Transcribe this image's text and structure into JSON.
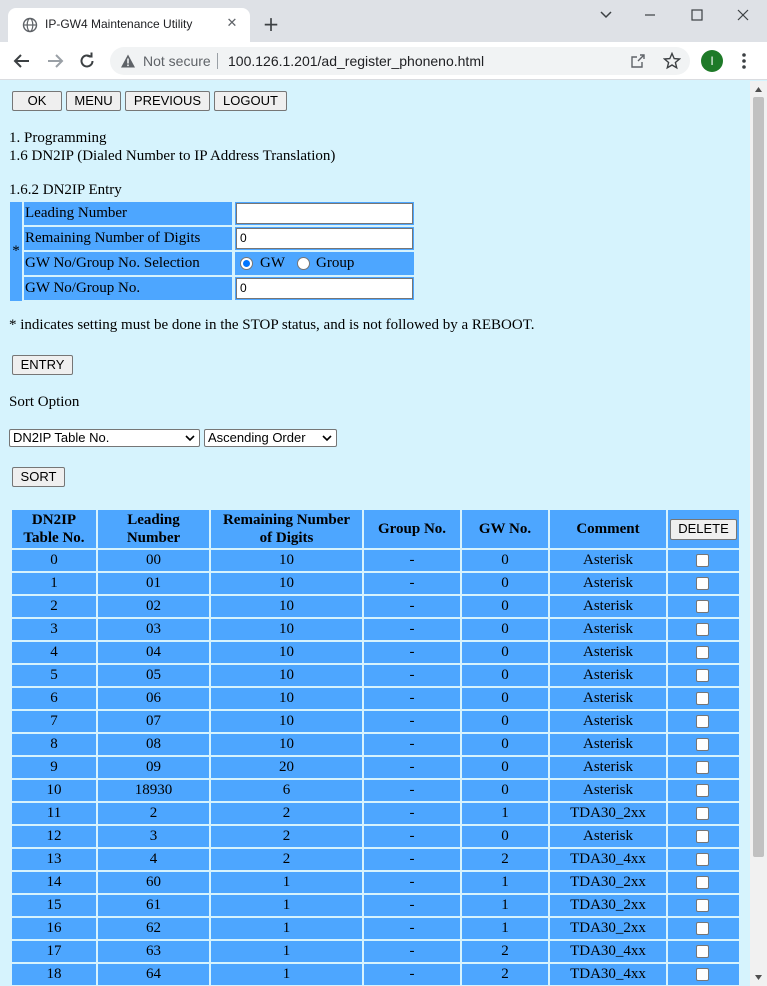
{
  "browser": {
    "tab_title": "IP-GW4 Maintenance Utility",
    "tab_close": "✕",
    "new_tab": "+",
    "security_label": "Not secure",
    "url": "100.126.1.201/ad_register_phoneno.html",
    "profile_initial": "I"
  },
  "nav_buttons": {
    "ok": "OK",
    "menu": "MENU",
    "previous": "PREVIOUS",
    "logout": "LOGOUT"
  },
  "breadcrumb": {
    "line1": "1. Programming",
    "line2": "1.6 DN2IP (Dialed Number to IP Address Translation)",
    "section": "1.6.2 DN2IP Entry"
  },
  "form": {
    "star": "*",
    "leading_number_label": "Leading Number",
    "leading_number_value": "",
    "remaining_digits_label": "Remaining Number of Digits",
    "remaining_digits_value": "0",
    "selection_label": "GW No/Group No. Selection",
    "radio_gw": "GW",
    "radio_group": "Group",
    "gw_group_no_label": "GW No/Group No.",
    "gw_group_no_value": "0"
  },
  "note": "* indicates setting must be done in the STOP status, and is not followed by a REBOOT.",
  "entry_button": "ENTRY",
  "sort": {
    "label": "Sort Option",
    "field_selected": "DN2IP Table No.",
    "order_selected": "Ascending Order",
    "button": "SORT"
  },
  "table": {
    "headers": {
      "table_no_line1": "DN2IP",
      "table_no_line2": "Table No.",
      "leading_line1": "Leading",
      "leading_line2": "Number",
      "remaining_line1": "Remaining Number",
      "remaining_line2": "of Digits",
      "group_no": "Group No.",
      "gw_no": "GW No.",
      "comment": "Comment",
      "delete_button": "DELETE"
    },
    "rows": [
      {
        "no": "0",
        "leading": "00",
        "remaining": "10",
        "group": "-",
        "gw": "0",
        "comment": "Asterisk"
      },
      {
        "no": "1",
        "leading": "01",
        "remaining": "10",
        "group": "-",
        "gw": "0",
        "comment": "Asterisk"
      },
      {
        "no": "2",
        "leading": "02",
        "remaining": "10",
        "group": "-",
        "gw": "0",
        "comment": "Asterisk"
      },
      {
        "no": "3",
        "leading": "03",
        "remaining": "10",
        "group": "-",
        "gw": "0",
        "comment": "Asterisk"
      },
      {
        "no": "4",
        "leading": "04",
        "remaining": "10",
        "group": "-",
        "gw": "0",
        "comment": "Asterisk"
      },
      {
        "no": "5",
        "leading": "05",
        "remaining": "10",
        "group": "-",
        "gw": "0",
        "comment": "Asterisk"
      },
      {
        "no": "6",
        "leading": "06",
        "remaining": "10",
        "group": "-",
        "gw": "0",
        "comment": "Asterisk"
      },
      {
        "no": "7",
        "leading": "07",
        "remaining": "10",
        "group": "-",
        "gw": "0",
        "comment": "Asterisk"
      },
      {
        "no": "8",
        "leading": "08",
        "remaining": "10",
        "group": "-",
        "gw": "0",
        "comment": "Asterisk"
      },
      {
        "no": "9",
        "leading": "09",
        "remaining": "20",
        "group": "-",
        "gw": "0",
        "comment": "Asterisk"
      },
      {
        "no": "10",
        "leading": "18930",
        "remaining": "6",
        "group": "-",
        "gw": "0",
        "comment": "Asterisk"
      },
      {
        "no": "11",
        "leading": "2",
        "remaining": "2",
        "group": "-",
        "gw": "1",
        "comment": "TDA30_2xx"
      },
      {
        "no": "12",
        "leading": "3",
        "remaining": "2",
        "group": "-",
        "gw": "0",
        "comment": "Asterisk"
      },
      {
        "no": "13",
        "leading": "4",
        "remaining": "2",
        "group": "-",
        "gw": "2",
        "comment": "TDA30_4xx"
      },
      {
        "no": "14",
        "leading": "60",
        "remaining": "1",
        "group": "-",
        "gw": "1",
        "comment": "TDA30_2xx"
      },
      {
        "no": "15",
        "leading": "61",
        "remaining": "1",
        "group": "-",
        "gw": "1",
        "comment": "TDA30_2xx"
      },
      {
        "no": "16",
        "leading": "62",
        "remaining": "1",
        "group": "-",
        "gw": "1",
        "comment": "TDA30_2xx"
      },
      {
        "no": "17",
        "leading": "63",
        "remaining": "1",
        "group": "-",
        "gw": "2",
        "comment": "TDA30_4xx"
      },
      {
        "no": "18",
        "leading": "64",
        "remaining": "1",
        "group": "-",
        "gw": "2",
        "comment": "TDA30_4xx"
      }
    ]
  },
  "colors": {
    "page_bg": "#d6f3fd",
    "cell_bg": "#4da6ff",
    "radio_checked": "#0075ff"
  }
}
